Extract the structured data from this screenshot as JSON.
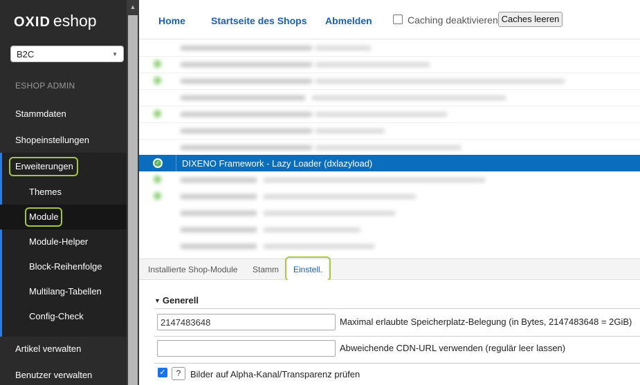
{
  "sidebar": {
    "logo_bold": "OXID",
    "logo_light": "eshop",
    "shop_select": "B2C",
    "admin_label": "ESHOP ADMIN",
    "items": [
      {
        "label": "Stammdaten"
      },
      {
        "label": "Shopeinstellungen"
      },
      {
        "label": "Erweiterungen"
      }
    ],
    "subitems": [
      {
        "label": "Themes"
      },
      {
        "label": "Module"
      },
      {
        "label": "Module-Helper"
      },
      {
        "label": "Block-Reihenfolge"
      },
      {
        "label": "Multilang-Tabellen"
      },
      {
        "label": "Config-Check"
      }
    ],
    "bottom_items": [
      {
        "label": "Artikel verwalten"
      },
      {
        "label": "Benutzer verwalten"
      }
    ]
  },
  "topbar": {
    "home": "Home",
    "shop_start": "Startseite des Shops",
    "logout": "Abmelden",
    "caching_label": "Caching deaktivieren",
    "clear_caches": "Caches leeren"
  },
  "modules": {
    "selected_label": "DIXENO Framework - Lazy Loader (dxlazyload)"
  },
  "tabs": [
    {
      "label": "Installierte Shop-Module"
    },
    {
      "label": "Stamm"
    },
    {
      "label": "Einstell."
    }
  ],
  "settings": {
    "group_title": "Generell",
    "fields": [
      {
        "value": "2147483648",
        "label": "Maximal erlaubte Speicherplatz-Belegung (in Bytes, 2147483648 = 2GiB)"
      },
      {
        "value": "",
        "label": "Abweichende CDN-URL verwenden (regulär leer lassen)"
      }
    ],
    "checkbox_label": "Bilder auf Alpha-Kanal/Transparenz prüfen",
    "checkbox_checked": true,
    "help_label": "?"
  },
  "colors": {
    "accent": "#0b6dbd",
    "highlight": "#a6c73a",
    "sidebar_bg": "#2b2b2b"
  }
}
